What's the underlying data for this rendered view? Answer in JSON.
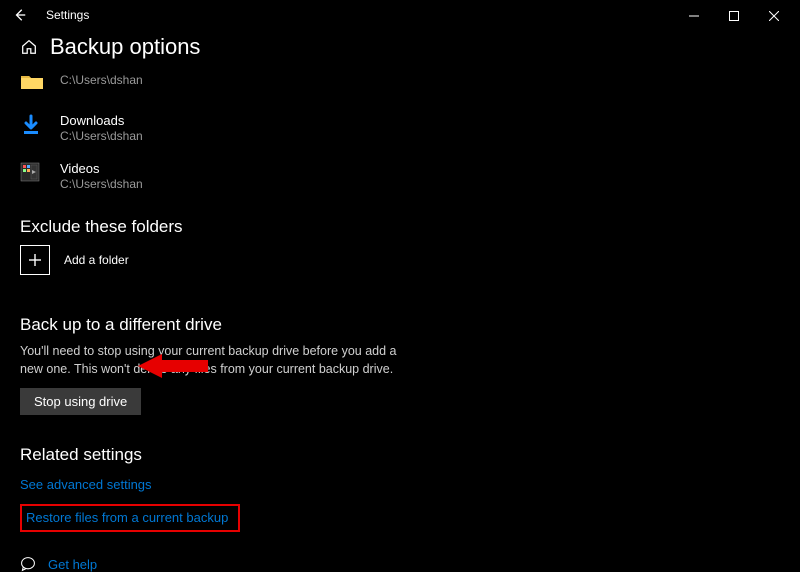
{
  "app": {
    "title": "Settings"
  },
  "header": {
    "title": "Backup options"
  },
  "folders": [
    {
      "name": "",
      "path": "C:\\Users\\dshan"
    },
    {
      "name": "Downloads",
      "path": "C:\\Users\\dshan"
    },
    {
      "name": "Videos",
      "path": "C:\\Users\\dshan"
    }
  ],
  "exclude": {
    "heading": "Exclude these folders",
    "add_label": "Add a folder"
  },
  "different_drive": {
    "heading": "Back up to a different drive",
    "desc": "You'll need to stop using your current backup drive before you add a new one. This won't delete any files from your current backup drive.",
    "button": "Stop using drive"
  },
  "related": {
    "heading": "Related settings",
    "advanced": "See advanced settings",
    "restore": "Restore files from a current backup"
  },
  "help": {
    "label": "Get help"
  }
}
